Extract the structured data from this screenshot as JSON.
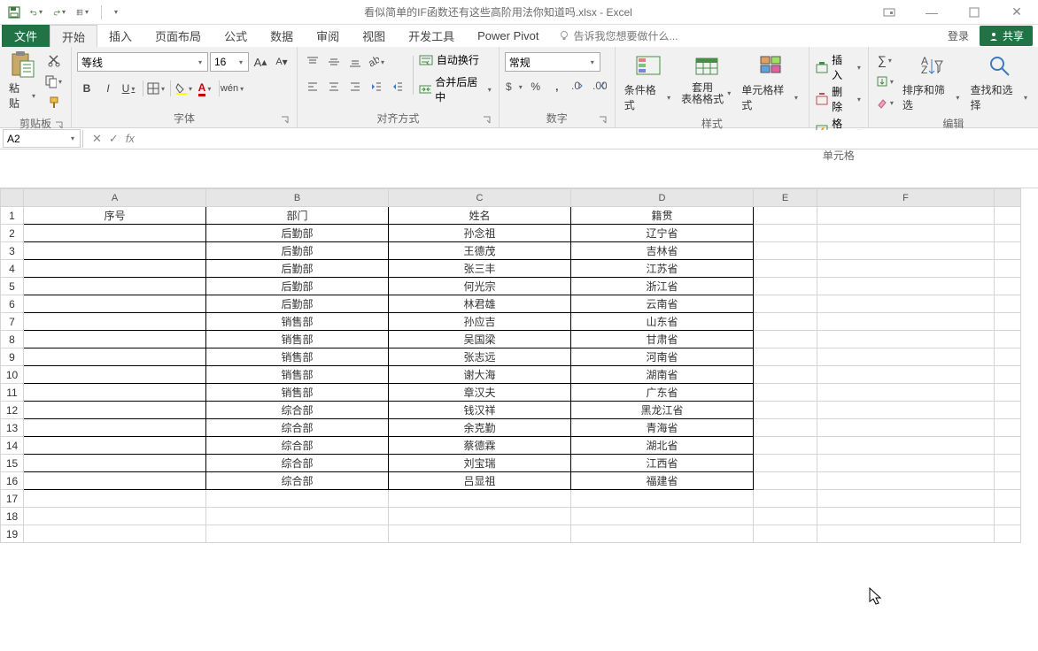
{
  "title": "看似简单的IF函数还有这些高阶用法你知道吗.xlsx - Excel",
  "qat": {
    "save": "save",
    "undo": "undo",
    "redo": "redo",
    "new": "new"
  },
  "tabs": {
    "file": "文件",
    "home": "开始",
    "insert": "插入",
    "layout": "页面布局",
    "formulas": "公式",
    "data": "数据",
    "review": "审阅",
    "view": "视图",
    "dev": "开发工具",
    "pivot": "Power Pivot"
  },
  "tell_me": "告诉我您想要做什么...",
  "login": "登录",
  "share": "共享",
  "ribbon": {
    "clipboard": {
      "paste": "粘贴",
      "group": "剪贴板"
    },
    "font": {
      "name": "等线",
      "size": "16",
      "group": "字体"
    },
    "align": {
      "wrap": "自动换行",
      "merge": "合并后居中",
      "group": "对齐方式"
    },
    "number": {
      "format": "常规",
      "group": "数字"
    },
    "styles": {
      "cond": "条件格式",
      "table": "套用\n表格格式",
      "cell": "单元格样式",
      "group": "样式"
    },
    "cells": {
      "insert": "插入",
      "delete": "删除",
      "format": "格式",
      "group": "单元格"
    },
    "editing": {
      "sort": "排序和筛选",
      "find": "查找和选择",
      "group": "编辑"
    }
  },
  "name_box": "A2",
  "formula": "",
  "columns": [
    "A",
    "B",
    "C",
    "D",
    "E",
    "F"
  ],
  "headers": {
    "A": "序号",
    "B": "部门",
    "C": "姓名",
    "D": "籍贯"
  },
  "rows": [
    {
      "n": "1",
      "b": "部门",
      "c": "姓名",
      "d": "籍贯",
      "a": "序号",
      "header": true
    },
    {
      "n": "2",
      "a": "",
      "b": "后勤部",
      "c": "孙念祖",
      "d": "辽宁省"
    },
    {
      "n": "3",
      "a": "",
      "b": "后勤部",
      "c": "王德茂",
      "d": "吉林省"
    },
    {
      "n": "4",
      "a": "",
      "b": "后勤部",
      "c": "张三丰",
      "d": "江苏省"
    },
    {
      "n": "5",
      "a": "",
      "b": "后勤部",
      "c": "何光宗",
      "d": "浙江省"
    },
    {
      "n": "6",
      "a": "",
      "b": "后勤部",
      "c": "林君雄",
      "d": "云南省"
    },
    {
      "n": "7",
      "a": "",
      "b": "销售部",
      "c": "孙应吉",
      "d": "山东省"
    },
    {
      "n": "8",
      "a": "",
      "b": "销售部",
      "c": "吴国梁",
      "d": "甘肃省"
    },
    {
      "n": "9",
      "a": "",
      "b": "销售部",
      "c": "张志远",
      "d": "河南省"
    },
    {
      "n": "10",
      "a": "",
      "b": "销售部",
      "c": "谢大海",
      "d": "湖南省"
    },
    {
      "n": "11",
      "a": "",
      "b": "销售部",
      "c": "章汉夫",
      "d": "广东省"
    },
    {
      "n": "12",
      "a": "",
      "b": "综合部",
      "c": "钱汉祥",
      "d": "黑龙江省"
    },
    {
      "n": "13",
      "a": "",
      "b": "综合部",
      "c": "余克勤",
      "d": "青海省"
    },
    {
      "n": "14",
      "a": "",
      "b": "综合部",
      "c": "蔡德霖",
      "d": "湖北省"
    },
    {
      "n": "15",
      "a": "",
      "b": "综合部",
      "c": "刘宝瑞",
      "d": "江西省"
    },
    {
      "n": "16",
      "a": "",
      "b": "综合部",
      "c": "吕显祖",
      "d": "福建省"
    },
    {
      "n": "17",
      "a": "",
      "b": "",
      "c": "",
      "d": "",
      "empty": true
    },
    {
      "n": "18",
      "a": "",
      "b": "",
      "c": "",
      "d": "",
      "empty": true
    },
    {
      "n": "19",
      "a": "",
      "b": "",
      "c": "",
      "d": "",
      "empty": true
    }
  ]
}
